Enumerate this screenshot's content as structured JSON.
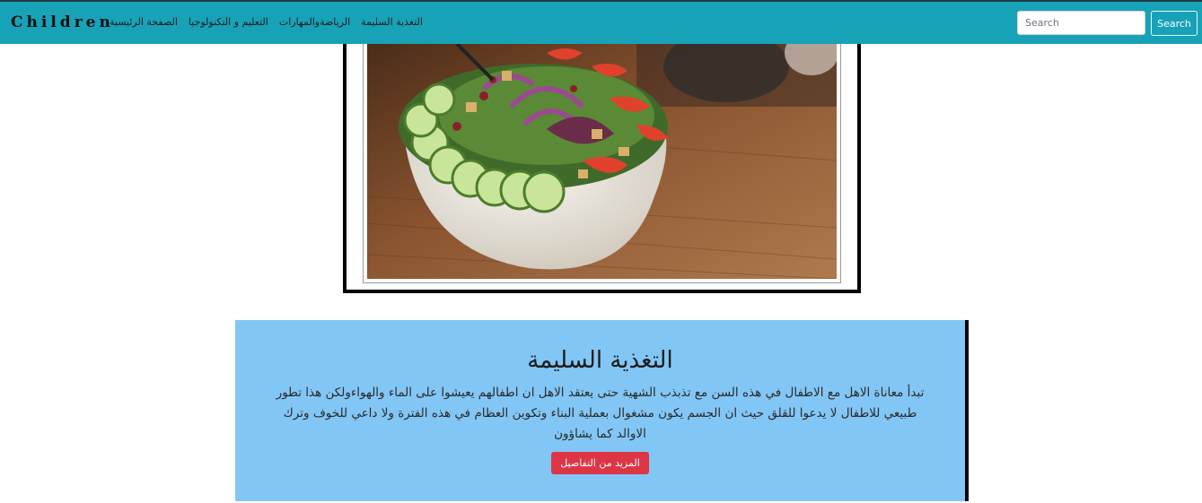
{
  "navbar": {
    "brand": "Children",
    "links": [
      {
        "label": "الصفحة الرئيسية"
      },
      {
        "label": "التعليم و التكنولوجيا"
      },
      {
        "label": "الرياضةوالمهارات"
      },
      {
        "label": "التغذية السليمة"
      }
    ],
    "search_placeholder": "Search",
    "search_button": "Search",
    "background_color": "#17a2b8"
  },
  "hero_image": {
    "subject": "salad-bowl-photo"
  },
  "card": {
    "title": "التغذية السليمة",
    "text": "تبدأ معاناة الاهل مع الاطفال في هذه السن مع تذبذب الشهية حتى يعتقد الاهل ان اطفالهم يعيشوا على الماء والهواءولكن هذا تطور طبيعي للاطفال لا يدعوا للقلق حيث ان الجسم يكون مشغوال بعملية البناء وتكوين العظام في هذه الفترة ولا داعي للخوف وترك الاوالد كما يشاؤون",
    "button_label": "المزيد من التفاصيل",
    "background_color": "#82c6f5",
    "button_color": "#dc3545"
  }
}
